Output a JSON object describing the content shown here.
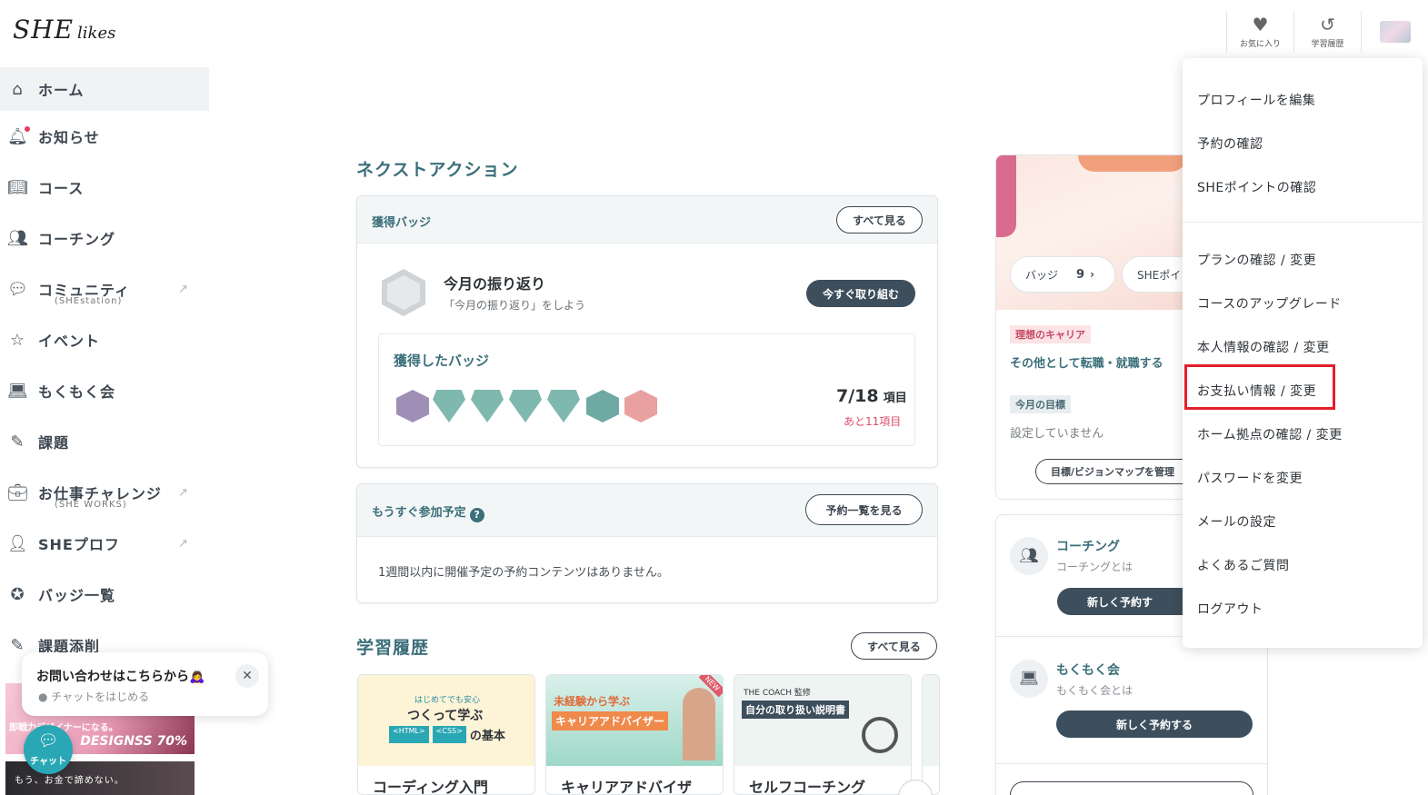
{
  "header": {
    "logo": "SHE",
    "logo_suffix": "likes",
    "favorites_label": "お気に入り",
    "history_label": "学習履歴"
  },
  "sidebar": {
    "items": [
      {
        "label": "ホーム",
        "icon": "home-icon"
      },
      {
        "label": "お知らせ",
        "icon": "bell-icon"
      },
      {
        "label": "コース",
        "icon": "book-icon"
      },
      {
        "label": "コーチング",
        "icon": "people-icon"
      },
      {
        "label": "コミュニティ",
        "sub": "(SHEstation)",
        "icon": "chat-icon"
      },
      {
        "label": "イベント",
        "icon": "star-icon"
      },
      {
        "label": "もくもく会",
        "icon": "laptop-icon"
      },
      {
        "label": "課題",
        "icon": "pencil-icon"
      },
      {
        "label": "お仕事チャレンジ",
        "sub": "(SHE WORKS)",
        "icon": "briefcase-icon"
      },
      {
        "label": "SHEプロフ",
        "icon": "profile-icon"
      },
      {
        "label": "バッジ一覧",
        "icon": "badge-icon"
      },
      {
        "label": "課題添削",
        "icon": "pencil-icon"
      }
    ],
    "banner1_text": "即戦力デザイナーになる。",
    "banner1_brand": "DESIGNSS 70%",
    "banner2_text": "もう、お金で諦めない。"
  },
  "chat": {
    "popup_title": "お問い合わせはこちらから🙇‍♀️",
    "popup_sub": "チャットをはじめる",
    "close": "✕",
    "button_label": "チャット"
  },
  "main": {
    "next_action_title": "ネクストアクション",
    "badges_card": {
      "label": "獲得バッジ",
      "see_all": "すべて見る",
      "task_title": "今月の振り返り",
      "task_sub": "「今月の振り返り」をしよう",
      "task_button": "今すぐ取り組む",
      "earned_title": "獲得したバッジ",
      "count": "7/18",
      "count_unit": "項目",
      "remaining": "あと11項目"
    },
    "upcoming_card": {
      "label": "もうすぐ参加予定",
      "button": "予約一覧を見る",
      "empty": "1週間以内に開催予定の予約コンテンツはありません。"
    },
    "history_title": "学習履歴",
    "history_see_all": "すべて見る",
    "courses": [
      {
        "title": "コーディング入門",
        "thumb_line1": "はじめてでも安心",
        "thumb_line2": "つくって学ぶ",
        "thumb_line3": "の基本"
      },
      {
        "title": "キャリアアドバイザ",
        "thumb_line1": "未経験から学ぶ",
        "thumb_line2": "キャリアアドバイザー",
        "thumb_badge": "NEW"
      },
      {
        "title": "セルフコーチング",
        "thumb_line1": "THE COACH 監修",
        "thumb_line2": "自分の取り扱い説明書"
      }
    ]
  },
  "right": {
    "badge_chip_label": "バッジ",
    "badge_chip_count": "9",
    "point_chip_label": "SHEポイ",
    "career_tag": "理想のキャリア",
    "career_text": "その他として転職・就職する",
    "goal_tag": "今月の目標",
    "goal_text": "設定していません",
    "vision_button": "目標/ビジョンマップを管理",
    "coaching_title": "コーチング",
    "coaching_sub": "コーチングとは",
    "coaching_button": "新しく予約す",
    "mokumoku_title": "もくもく会",
    "mokumoku_sub": "もくもく会とは",
    "mokumoku_button": "新しく予約する"
  },
  "dropdown": {
    "items": [
      "プロフィールを編集",
      "予約の確認",
      "SHEポイントの確認",
      "プランの確認 / 変更",
      "コースのアップグレード",
      "本人情報の確認 / 変更",
      "お支払い情報 / 変更",
      "ホーム拠点の確認 / 変更",
      "パスワードを変更",
      "メールの設定",
      "よくあるご質問",
      "ログアウト"
    ]
  },
  "colors": {
    "accent_teal": "#3b6f7a",
    "dark_button": "#3d4e5c",
    "highlight_red": "#e3202a",
    "chat_teal": "#2aa7b5"
  }
}
